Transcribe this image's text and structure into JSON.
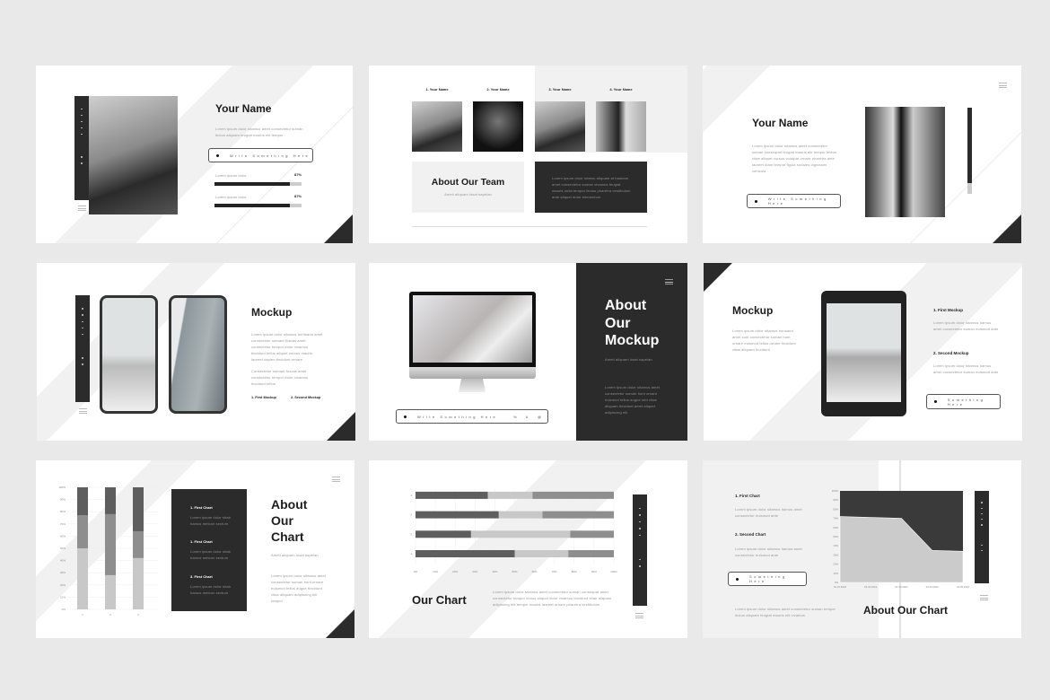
{
  "colors": {
    "background": "#e9e9e9",
    "dark": "#2b2b2b",
    "light": "#f1f1f1",
    "bar_dark": "#5e5e5e",
    "bar_mid": "#8e8e8e",
    "bar_light": "#c8c8c8"
  },
  "slide1": {
    "title": "Your Name",
    "lorem": "Lorem ipsum dolor sitamus amet consectetur suman lectus aliquam feugiat mauris elit tempor",
    "button": "Write Something Here",
    "skills": [
      {
        "label": "Lorem ipsum dolor",
        "value": "87%",
        "fraction": 0.87
      },
      {
        "label": "Lorem ipsum dolor",
        "value": "87%",
        "fraction": 0.87
      }
    ]
  },
  "slide2": {
    "names": [
      "1. Your Name",
      "2. Your Name",
      "3. Your Name",
      "4. Your Name"
    ],
    "title": "About Our Team",
    "subtitle": "Ameti aliquam losat sapelan",
    "lorem": "Lorem ipsum dolor sitamu aliquam at hasnam amet consectetur suman vivamus feugiat mauris nulla tempor lectus pharetra vestibulum ante aliquet dolor elementum"
  },
  "slide3": {
    "title": "Your Name",
    "lorem": "Lorem ipsum dolor sitamus amet consectetur suman consequat feugiat mauris elit tempor lectus vitae aliquet cursus volutpat ornare pharetra ante laoreet diam tempor ligula sodales dignissim vehicula",
    "button": "Write Something Here"
  },
  "slide4": {
    "title": "Mockup",
    "lorem1": "Lorem ipsum dolor sitamus huntsand amet consectetur sumant fuscas amet consectetur tempor dolor vivamus tincidunt tellus aliquet cursus mauris laoreet sapien tincidunt ornare",
    "lorem2": "Consectetur sumant fuscas amet consectetur tempor dolor vivamus tincidunt tellus",
    "items": [
      "1. First Mockup",
      "2. Second Mockup"
    ]
  },
  "slide5": {
    "title_lines": [
      "About",
      "Our",
      "Mockup"
    ],
    "subtitle": "Ameti aliquam losat sapelan",
    "lorem": "Lorem ipsum dolor sitamus amet consectetur suman hunt ornare euismod tellus augue sed vitae aliquam tincidunt amet aliquet adipiscing elit",
    "button": "Write Something Here",
    "icons": [
      "percent-icon",
      "hash-icon",
      "at-icon"
    ]
  },
  "slide6": {
    "title": "Mockup",
    "lorem": "Lorem ipsum dolor sitamus hunsand amet sunt consectetur suman hunt ornare euismod tellus ornare tincidunt vitae aliquam tincidunt",
    "items": [
      {
        "title": "1. First Mockup",
        "lorem": "Lorem ipsum dolor sitamus hamus amet consectetur suman euismod ante"
      },
      {
        "title": "2. Second Mockup",
        "lorem": "Lorem ipsum dolor sitamus hamus amet consectetur suman euismod ante"
      }
    ],
    "button": "Something Here"
  },
  "slide7": {
    "title_lines": [
      "About",
      "Our",
      "Chart"
    ],
    "subtitle": "Ameti aliquam losat sapelan",
    "lorem": "Lorem ipsum dolor sitamus amet consectetur suman hunt ornare euismod tellus augue tincidunt vitae aliquam adipiscing elit tempor",
    "items": [
      {
        "title": "1. First Chart",
        "lorem": "Lorem ipsum dolor sitab hamus metcon sectum"
      },
      {
        "title": "1. First Chart",
        "lorem": "Lorem ipsum dolor sitab hamus metcon sectum"
      },
      {
        "title": "3. First Chart",
        "lorem": "Lorem ipsum dolor sitab hamus metcon sectum"
      }
    ]
  },
  "slide8": {
    "title": "Our Chart",
    "lorem": "Lorem ipsum dolor sitamus amet consectetur suman consequat amet consectetur tempor lectus aliquet dolor vivamus tincidunt vitae aliquam adipiscing elit tempor mauris laoreet ornare pharetra vestibulum"
  },
  "slide9": {
    "title": "About Our Chart",
    "items": [
      {
        "title": "1. First Chart",
        "lorem": "Lorem ipsum dolor sitamus hamus amet consectetur euismod ante"
      },
      {
        "title": "2. Second Chart",
        "lorem": "Lorem ipsum dolor sitamus hamus amet consectetur euismod ante"
      }
    ],
    "button": "Something Here",
    "lorem": "Lorem ipsum dolor sitamus amet consectetur suman tempor lectus aliquam feugiat mauris elit vivamus"
  },
  "chart_data": [
    {
      "type": "bar",
      "stacked": true,
      "orientation": "vertical",
      "categories": [
        "1",
        "2",
        "3"
      ],
      "series": [
        {
          "values": [
            50,
            28,
            42
          ]
        },
        {
          "values": [
            27,
            50,
            22
          ]
        },
        {
          "values": [
            23,
            22,
            36
          ]
        }
      ],
      "yticks": [
        "0%",
        "10%",
        "20%",
        "30%",
        "40%",
        "50%",
        "60%",
        "70%",
        "80%",
        "90%",
        "100%"
      ],
      "ylim": [
        0,
        100
      ],
      "grid": true
    },
    {
      "type": "bar",
      "stacked": true,
      "orientation": "horizontal",
      "categories": [
        "1",
        "2",
        "3",
        "4"
      ],
      "series": [
        {
          "values": [
            50,
            28,
            42,
            36.5
          ]
        },
        {
          "values": [
            27,
            50,
            22,
            22.5
          ]
        },
        {
          "values": [
            23,
            22,
            36,
            41
          ]
        }
      ],
      "xticks": [
        "0%",
        "10%",
        "20%",
        "30%",
        "40%",
        "50%",
        "60%",
        "70%",
        "80%",
        "90%",
        "100%"
      ],
      "xlim": [
        0,
        100
      ],
      "grid": true
    },
    {
      "type": "area",
      "stacked": true,
      "x": [
        "01.01.2022",
        "01.02.2022",
        "01.03.2022",
        "01.04.2022",
        "01.05.2022"
      ],
      "series": [
        {
          "values": [
            72,
            71,
            70,
            35,
            34
          ]
        },
        {
          "values": [
            28,
            29,
            30,
            65,
            66
          ]
        }
      ],
      "yticks": [
        "0%",
        "10%",
        "20%",
        "30%",
        "40%",
        "50%",
        "60%",
        "70%",
        "80%",
        "90%",
        "100%"
      ],
      "ylim": [
        0,
        100
      ]
    }
  ]
}
